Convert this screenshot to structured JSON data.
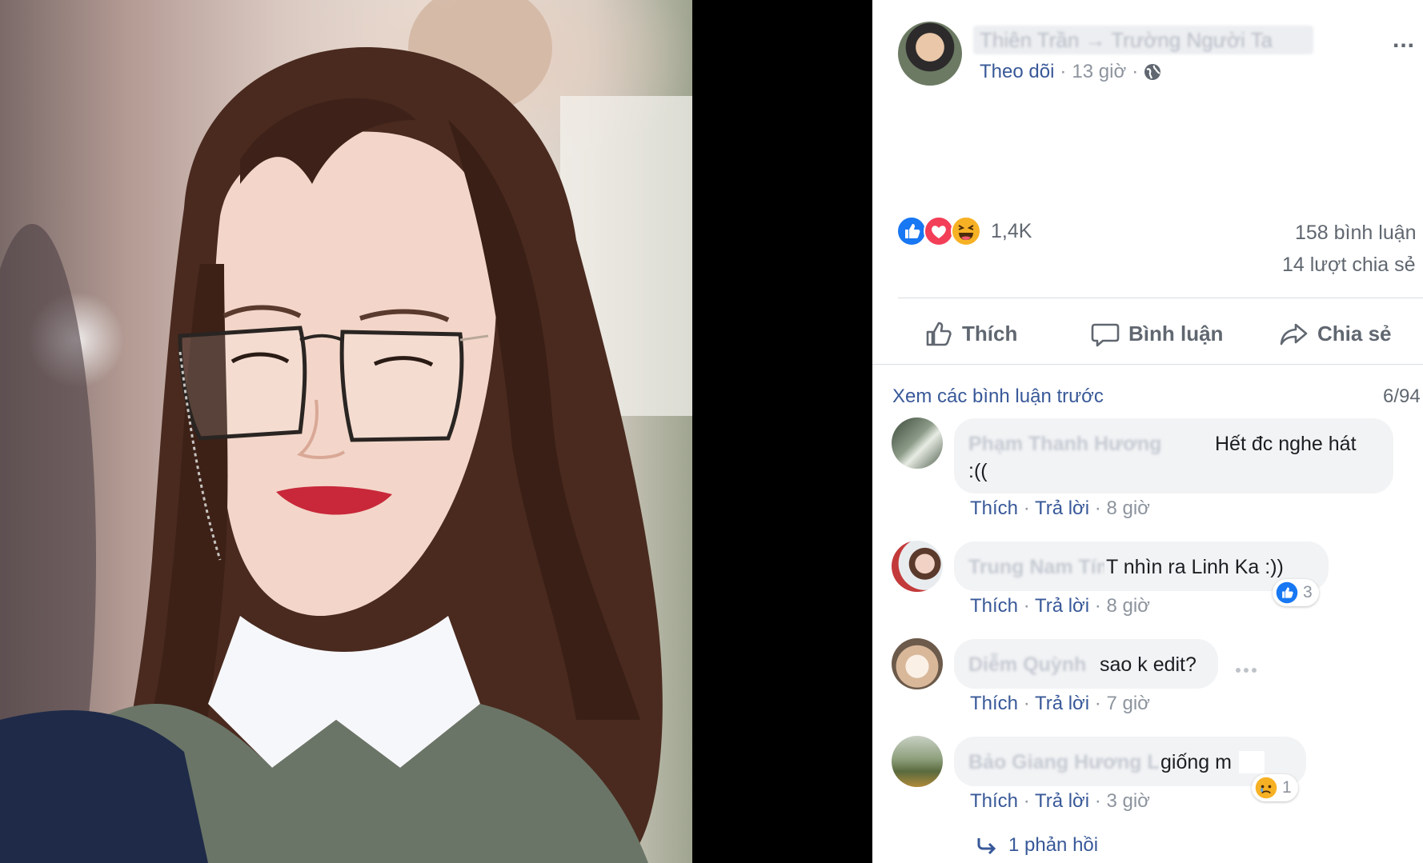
{
  "post": {
    "author_name": "Thiên Trần → Trường Người Ta",
    "follow_label": "Theo dõi",
    "time": "13 giờ",
    "separator": "·",
    "more_label": "...",
    "reaction_count": "1,4K",
    "comments_count": "158 bình luận",
    "shares_count": "14 lượt chia sẻ"
  },
  "actions": {
    "like": "Thích",
    "comment": "Bình luận",
    "share": "Chia sẻ"
  },
  "comments_header": {
    "view_previous": "Xem các bình luận trước",
    "pager": "6/94"
  },
  "comments": [
    {
      "author": "Phạm Thanh Hương",
      "text_line1": "Hết đc nghe hát",
      "text_line2": ":((",
      "like": "Thích",
      "reply": "Trả lời",
      "time": "8 giờ"
    },
    {
      "author": "Trung Nam Tín",
      "prefix": "T",
      "text_line1": "T nhìn ra Linh Ka :))",
      "like": "Thích",
      "reply": "Trả lời",
      "time": "8 giờ",
      "reaction_count": "3"
    },
    {
      "author": "Diễm Quỳnh",
      "text_line1": "sao k edit?",
      "like": "Thích",
      "reply": "Trả lời",
      "time": "7 giờ"
    },
    {
      "author": "Bảo Giang Hương Lan",
      "text_line1": "giống m",
      "like": "Thích",
      "reply": "Trả lời",
      "time": "3 giờ",
      "reaction_count": "1"
    }
  ],
  "replies_link": "1 phản hồi",
  "colors": {
    "facebook_blue": "#385898",
    "like_blue": "#1877f2",
    "love_red": "#f33e58",
    "haha_yellow": "#f7b125",
    "muted_grey": "#8d949e"
  },
  "icons": [
    "like-reaction-icon",
    "love-reaction-icon",
    "haha-reaction-icon",
    "globe-icon",
    "thumbs-up-icon",
    "comment-icon",
    "share-icon",
    "reply-arrow-icon",
    "sad-reaction-icon"
  ]
}
